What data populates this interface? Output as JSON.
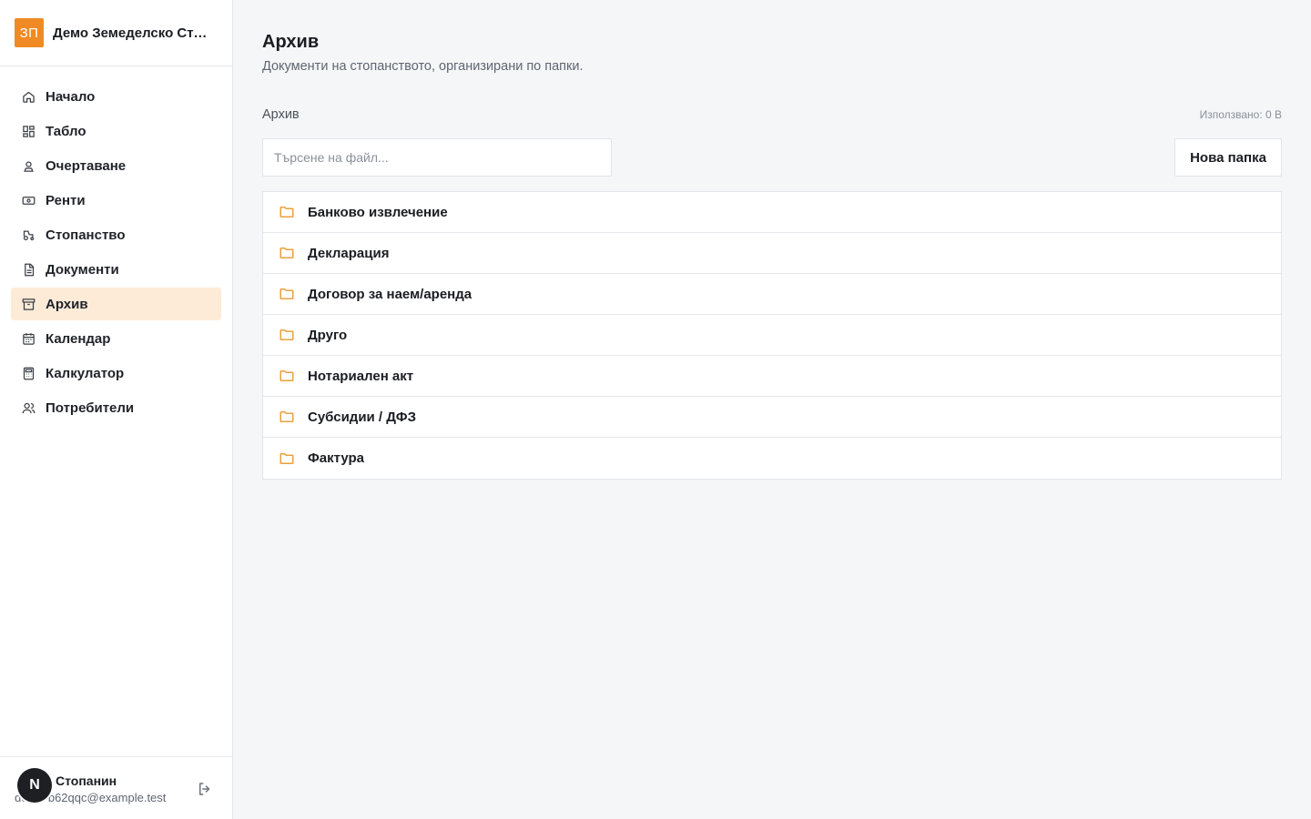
{
  "brand": {
    "badge": "ЗП",
    "name": "Демо Земеделско Стопанство",
    "accent": "#ef8a24"
  },
  "nav": [
    {
      "label": "Начало",
      "icon": "home-icon",
      "active": false
    },
    {
      "label": "Табло",
      "icon": "dashboard-icon",
      "active": false
    },
    {
      "label": "Очертаване",
      "icon": "map-pin-icon",
      "active": false
    },
    {
      "label": "Ренти",
      "icon": "banknote-icon",
      "active": false
    },
    {
      "label": "Стопанство",
      "icon": "tractor-icon",
      "active": false
    },
    {
      "label": "Документи",
      "icon": "document-icon",
      "active": false
    },
    {
      "label": "Архив",
      "icon": "archive-icon",
      "active": true
    },
    {
      "label": "Календар",
      "icon": "calendar-icon",
      "active": false
    },
    {
      "label": "Калкулатор",
      "icon": "calculator-icon",
      "active": false
    },
    {
      "label": "Потребители",
      "icon": "users-icon",
      "active": false
    }
  ],
  "user": {
    "name": "Стопанин",
    "email": "demo-b62qqc@example.test",
    "avatar": "N"
  },
  "page": {
    "title": "Архив",
    "subtitle": "Документи на стопанството, организирани по папки.",
    "breadcrumb": "Архив",
    "usage": "Използвано: 0 B"
  },
  "search": {
    "placeholder": "Търсене на файл...",
    "value": ""
  },
  "actions": {
    "new_folder": "Нова папка"
  },
  "folders": [
    {
      "name": "Банково извлечение"
    },
    {
      "name": "Декларация"
    },
    {
      "name": "Договор за наем/аренда"
    },
    {
      "name": "Друго"
    },
    {
      "name": "Нотариален акт"
    },
    {
      "name": "Субсидии / ДФЗ"
    },
    {
      "name": "Фактура"
    }
  ]
}
